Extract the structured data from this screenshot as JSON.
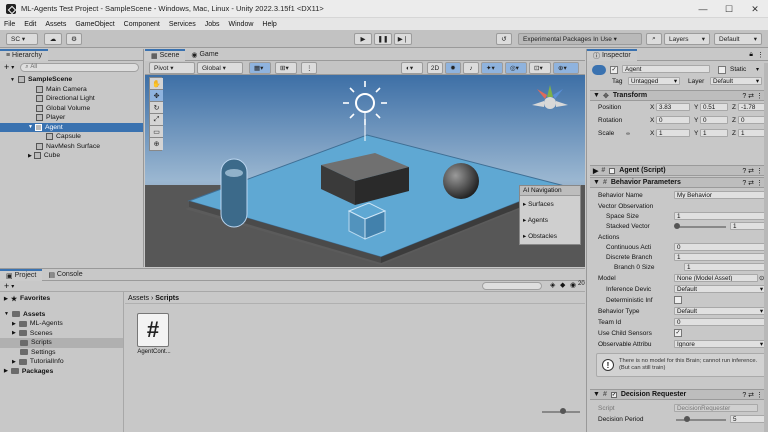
{
  "window": {
    "title": "ML-Agents Test Project - SampleScene - Windows, Mac, Linux - Unity 2022.3.15f1 <DX11>",
    "minimize": "—",
    "maximize": "☐",
    "close": "✕"
  },
  "menu": [
    "File",
    "Edit",
    "Assets",
    "GameObject",
    "Component",
    "Services",
    "Jobs",
    "Window",
    "Help"
  ],
  "toolbar": {
    "account": "SC ▾",
    "packages": "Experimental Packages In Use ▾",
    "layers": "Layers",
    "layout": "Default"
  },
  "hierarchy": {
    "tab": "Hierarchy",
    "search_placeholder": "All",
    "items": [
      {
        "label": "SampleScene"
      },
      {
        "label": "Main Camera"
      },
      {
        "label": "Directional Light"
      },
      {
        "label": "Global Volume"
      },
      {
        "label": "Player"
      },
      {
        "label": "Agent"
      },
      {
        "label": "Capsule"
      },
      {
        "label": "NavMesh Surface"
      },
      {
        "label": "Cube"
      }
    ]
  },
  "scene": {
    "tabs": [
      "Scene",
      "Game"
    ],
    "pivot": "Pivot ▾",
    "global": "Global ▾",
    "mode_2d": "2D",
    "overlay": {
      "title": "AI Navigation",
      "items": [
        "Surfaces",
        "Agents",
        "Obstacles"
      ]
    }
  },
  "project": {
    "tabs": [
      "Project",
      "Console"
    ],
    "favorites": "Favorites",
    "assets": "Assets",
    "folders": [
      "ML-Agents",
      "Scenes",
      "Scripts",
      "Settings",
      "TutorialInfo"
    ],
    "packages": "Packages",
    "breadcrumb": [
      "Assets",
      "Scripts"
    ],
    "file": {
      "name": "AgentCont...",
      "glyph": "#"
    },
    "count": "20"
  },
  "inspector": {
    "tab": "Inspector",
    "object_name": "Agent",
    "static_label": "Static",
    "tag_label": "Tag",
    "tag_value": "Untagged",
    "layer_label": "Layer",
    "layer_value": "Default",
    "transform": {
      "title": "Transform",
      "position": {
        "label": "Position",
        "x": "3.83",
        "y": "0.51",
        "z": "-1.78"
      },
      "rotation": {
        "label": "Rotation",
        "x": "0",
        "y": "0",
        "z": "0"
      },
      "scale": {
        "label": "Scale",
        "x": "1",
        "y": "1",
        "z": "1"
      }
    },
    "agent_script": {
      "title": "Agent (Script)"
    },
    "behavior": {
      "title": "Behavior Parameters",
      "behavior_name_label": "Behavior Name",
      "behavior_name": "My Behavior",
      "vector_obs": "Vector Observation",
      "space_size_label": "Space Size",
      "space_size": "1",
      "stacked_label": "Stacked Vector",
      "stacked": "1",
      "actions": "Actions",
      "continuous_label": "Continuous Acti",
      "continuous": "0",
      "discrete_label": "Discrete Branch",
      "discrete": "1",
      "branch0_label": "Branch 0 Size",
      "branch0": "1",
      "model_label": "Model",
      "model": "None (Model Asset)",
      "inference_label": "Inference Devic",
      "inference": "Default",
      "deterministic_label": "Deterministic Inf",
      "behavior_type_label": "Behavior Type",
      "behavior_type": "Default",
      "team_label": "Team Id",
      "team": "0",
      "child_sensors_label": "Use Child Sensors",
      "observable_label": "Observable Attribu",
      "observable": "Ignore",
      "warning": "There is no model for this Brain; cannot run inference. (But can still train)"
    },
    "decision": {
      "title": "Decision Requester",
      "script_label": "Script",
      "script": "DecisionRequester",
      "period_label": "Decision Period",
      "period": "5"
    }
  },
  "colors": {
    "accent": "#3a72b0",
    "sky": "#3d6fa6",
    "plane": "#5fa8d3"
  }
}
